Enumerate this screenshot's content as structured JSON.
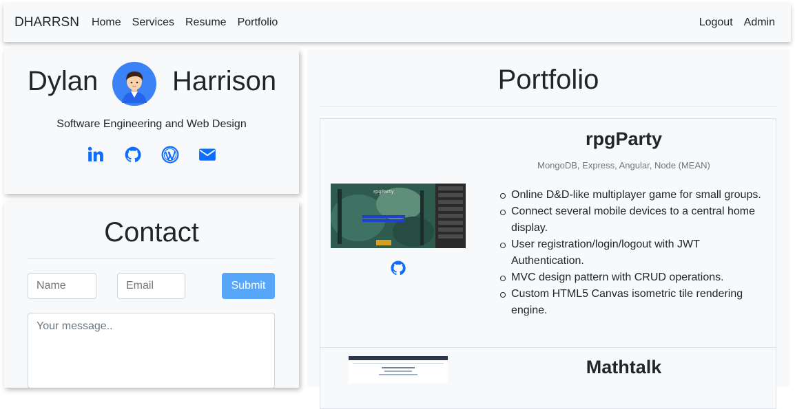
{
  "nav": {
    "brand": "DHARRSN",
    "links": [
      "Home",
      "Services",
      "Resume",
      "Portfolio"
    ],
    "right_links": [
      "Logout",
      "Admin"
    ]
  },
  "profile": {
    "first_name": "Dylan",
    "last_name": "Harrison",
    "tagline": "Software Engineering and Web Design",
    "socials": [
      "linkedin-icon",
      "github-icon",
      "wordpress-icon",
      "envelope-icon"
    ]
  },
  "contact": {
    "title": "Contact",
    "name_placeholder": "Name",
    "email_placeholder": "Email",
    "submit_label": "Submit",
    "message_placeholder": "Your message.."
  },
  "portfolio": {
    "title": "Portfolio",
    "projects": [
      {
        "title": "rpgParty",
        "stack": "MongoDB, Express, Angular, Node (MEAN)",
        "features": [
          "Online D&D-like multiplayer game for small groups.",
          "Connect several mobile devices to a central home display.",
          "User registration/login/logout with JWT Authentication.",
          "MVC design pattern with CRUD operations.",
          "Custom HTML5 Canvas isometric tile rendering engine."
        ]
      },
      {
        "title": "Mathtalk"
      }
    ]
  },
  "colors": {
    "accent": "#0d6efd",
    "submit_bg": "#58a6f7",
    "panel_bg": "#f8f9fa"
  }
}
